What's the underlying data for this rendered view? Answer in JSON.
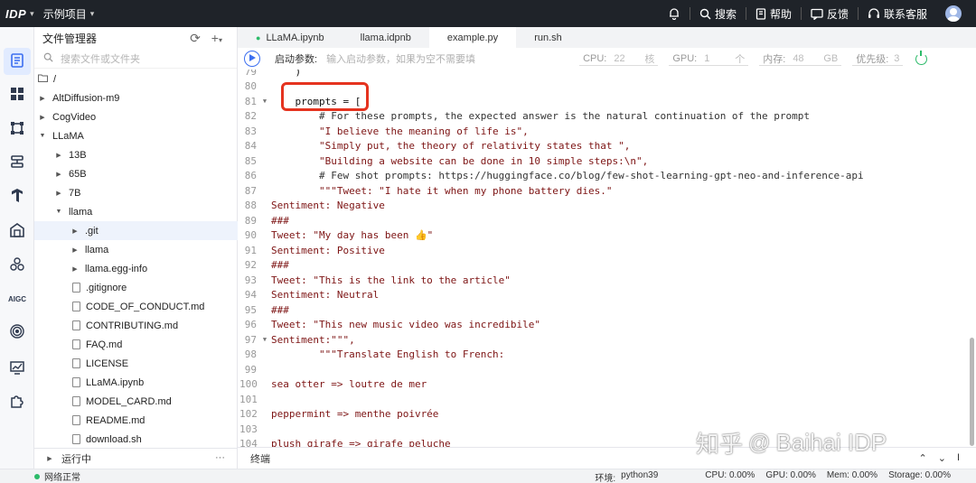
{
  "topbar": {
    "logo": "IDP",
    "project": "示例项目",
    "search": "搜索",
    "help": "帮助",
    "feedback": "反馈",
    "support": "联系客服"
  },
  "sidebar": {
    "aigc": "AIGC"
  },
  "explorer": {
    "title": "文件管理器",
    "search_placeholder": "搜索文件或文件夹",
    "root": "/",
    "items": [
      {
        "label": "AltDiffusion-m9"
      },
      {
        "label": "CogVideo"
      },
      {
        "label": "LLaMA"
      },
      {
        "label": "13B"
      },
      {
        "label": "65B"
      },
      {
        "label": "7B"
      },
      {
        "label": "llama"
      },
      {
        "label": ".git"
      },
      {
        "label": "llama"
      },
      {
        "label": "llama.egg-info"
      },
      {
        "label": ".gitignore"
      },
      {
        "label": "CODE_OF_CONDUCT.md"
      },
      {
        "label": "CONTRIBUTING.md"
      },
      {
        "label": "FAQ.md"
      },
      {
        "label": "LICENSE"
      },
      {
        "label": "LLaMA.ipynb"
      },
      {
        "label": "MODEL_CARD.md"
      },
      {
        "label": "README.md"
      },
      {
        "label": "download.sh"
      }
    ],
    "running": "运行中",
    "running_more": "···"
  },
  "tabs": [
    {
      "label": "LLaMA.ipynb"
    },
    {
      "label": "llama.idpnb"
    },
    {
      "label": "example.py"
    },
    {
      "label": "run.sh"
    }
  ],
  "toolbar": {
    "args_label": "启动参数:",
    "args_placeholder": "输入启动参数，如果为空不需要填",
    "cpu_label": "CPU:",
    "cpu_value": "22",
    "cpu_unit": "核",
    "gpu_label": "GPU:",
    "gpu_value": "1",
    "gpu_unit": "个",
    "mem_label": "内存:",
    "mem_value": "48",
    "mem_unit": "GB",
    "prio_label": "优先级:",
    "prio_value": "3"
  },
  "editor": {
    "lines": [
      {
        "n": "79",
        "t": "    )"
      },
      {
        "n": "80",
        "t": ""
      },
      {
        "n": "81",
        "t": "    prompts = ["
      },
      {
        "n": "82",
        "t": "        # For these prompts, the expected answer is the natural continuation of the prompt"
      },
      {
        "n": "83",
        "t": "        \"I believe the meaning of life is\","
      },
      {
        "n": "84",
        "t": "        \"Simply put, the theory of relativity states that \","
      },
      {
        "n": "85",
        "t": "        \"Building a website can be done in 10 simple steps:\\n\","
      },
      {
        "n": "86",
        "t": "        # Few shot prompts: https://huggingface.co/blog/few-shot-learning-gpt-neo-and-inference-api"
      },
      {
        "n": "87",
        "t": "        \"\"\"Tweet: \"I hate it when my phone battery dies.\""
      },
      {
        "n": "88",
        "t": "Sentiment: Negative"
      },
      {
        "n": "89",
        "t": "###"
      },
      {
        "n": "90",
        "t": "Tweet: \"My day has been 👍\""
      },
      {
        "n": "91",
        "t": "Sentiment: Positive"
      },
      {
        "n": "92",
        "t": "###"
      },
      {
        "n": "93",
        "t": "Tweet: \"This is the link to the article\""
      },
      {
        "n": "94",
        "t": "Sentiment: Neutral"
      },
      {
        "n": "95",
        "t": "###"
      },
      {
        "n": "96",
        "t": "Tweet: \"This new music video was incredibile\""
      },
      {
        "n": "97",
        "t": "Sentiment:\"\"\","
      },
      {
        "n": "98",
        "t": "        \"\"\"Translate English to French:"
      },
      {
        "n": "99",
        "t": ""
      },
      {
        "n": "100",
        "t": "sea otter => loutre de mer"
      },
      {
        "n": "101",
        "t": ""
      },
      {
        "n": "102",
        "t": "peppermint => menthe poivrée"
      },
      {
        "n": "103",
        "t": ""
      },
      {
        "n": "104",
        "t": "plush girafe => girafe peluche"
      }
    ]
  },
  "terminal": {
    "label": "终端",
    "ctrl_a": "⌃",
    "ctrl_b": "⌄",
    "ctrl_c": "I"
  },
  "status": {
    "network": "网络正常",
    "env_label": "环境:",
    "env_value": "python39",
    "cpu": "CPU: 0.00%",
    "gpu": "GPU: 0.00%",
    "mem": "Mem: 0.00%",
    "storage": "Storage: 0.00%"
  },
  "watermark": {
    "zhihu": "知乎",
    "at": "@",
    "account": "Baihai IDP"
  }
}
